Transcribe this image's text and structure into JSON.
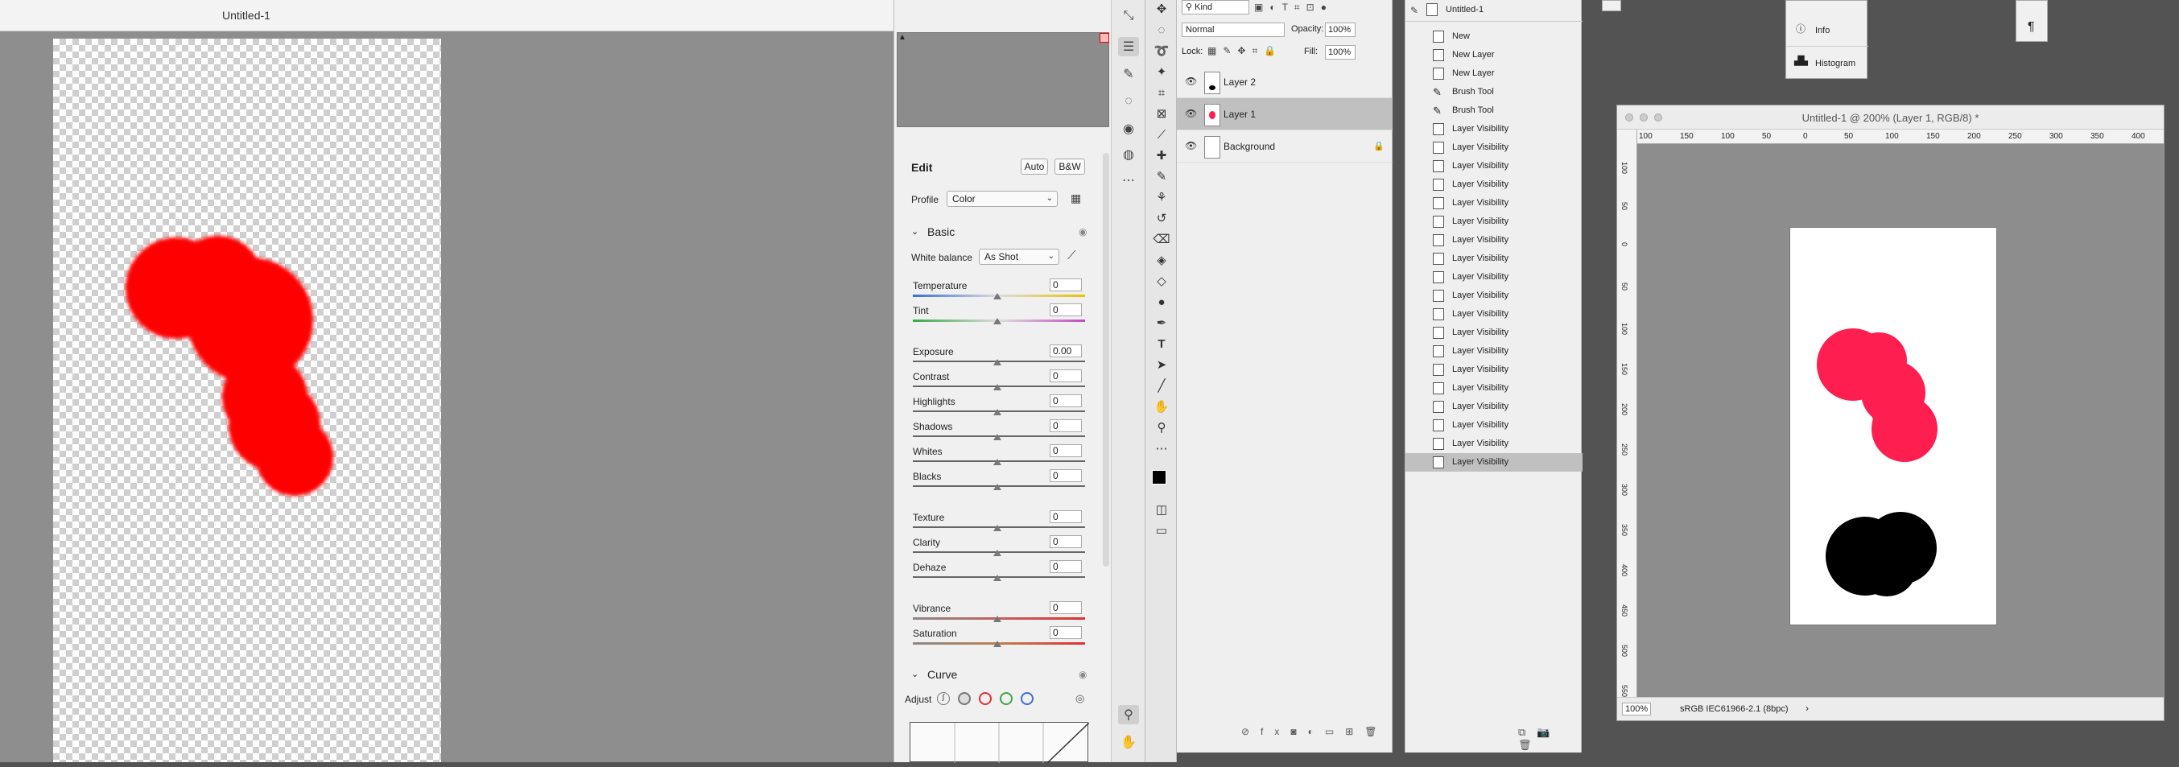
{
  "acr": {
    "title": "Untitled-1",
    "edit_label": "Edit",
    "auto_label": "Auto",
    "bw_label": "B&W",
    "profile_label": "Profile",
    "profile_value": "Color",
    "basic_label": "Basic",
    "white_balance_label": "White balance",
    "white_balance_value": "As Shot",
    "sliders": [
      {
        "label": "Temperature",
        "value": "0"
      },
      {
        "label": "Tint",
        "value": "0"
      },
      {
        "label": "Exposure",
        "value": "0.00"
      },
      {
        "label": "Contrast",
        "value": "0"
      },
      {
        "label": "Highlights",
        "value": "0"
      },
      {
        "label": "Shadows",
        "value": "0"
      },
      {
        "label": "Whites",
        "value": "0"
      },
      {
        "label": "Blacks",
        "value": "0"
      },
      {
        "label": "Texture",
        "value": "0"
      },
      {
        "label": "Clarity",
        "value": "0"
      },
      {
        "label": "Dehaze",
        "value": "0"
      },
      {
        "label": "Vibrance",
        "value": "0"
      },
      {
        "label": "Saturation",
        "value": "0"
      }
    ],
    "curve_label": "Curve",
    "adjust_label": "Adjust"
  },
  "layers": {
    "kind_label": "Kind",
    "blend_mode": "Normal",
    "opacity_label": "Opacity:",
    "opacity_value": "100%",
    "lock_label": "Lock:",
    "fill_label": "Fill:",
    "fill_value": "100%",
    "items": [
      {
        "name": "Layer 2"
      },
      {
        "name": "Layer 1"
      },
      {
        "name": "Background"
      }
    ]
  },
  "history": {
    "doc_name": "Untitled-1",
    "items": [
      "New",
      "New Layer",
      "New Layer",
      "Brush Tool",
      "Brush Tool",
      "Layer Visibility",
      "Layer Visibility",
      "Layer Visibility",
      "Layer Visibility",
      "Layer Visibility",
      "Layer Visibility",
      "Layer Visibility",
      "Layer Visibility",
      "Layer Visibility",
      "Layer Visibility",
      "Layer Visibility",
      "Layer Visibility",
      "Layer Visibility",
      "Layer Visibility",
      "Layer Visibility",
      "Layer Visibility",
      "Layer Visibility",
      "Layer Visibility",
      "Layer Visibility"
    ]
  },
  "panels": {
    "info_label": "Info",
    "histogram_label": "Histogram"
  },
  "doc": {
    "title": "Untitled-1 @ 200% (Layer 1, RGB/8) *",
    "zoom": "100%",
    "profile": "sRGB IEC61966-2.1 (8bpc)",
    "ruler_top": [
      "100",
      "150",
      "100",
      "50",
      "0",
      "50",
      "100",
      "150",
      "200",
      "250",
      "300",
      "350",
      "400"
    ],
    "ruler_left": [
      "100",
      "50",
      "0",
      "50",
      "100",
      "150",
      "200",
      "250",
      "300",
      "350",
      "400",
      "450",
      "500",
      "550"
    ]
  },
  "colors": {
    "red": "#ff0000",
    "pink": "#ff1e50",
    "black": "#000000",
    "highlight": "#c0c0c0"
  }
}
